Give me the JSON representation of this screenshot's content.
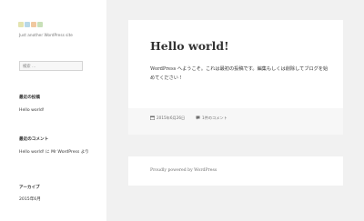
{
  "sidebar": {
    "logo": {
      "colors": [
        "#e4e4b0",
        "#b8d8e8",
        "#f0c8a0",
        "#c8e0b8"
      ]
    },
    "tagline": "Just another WordPress site",
    "search": {
      "placeholder": "検索 …"
    },
    "recent_posts": {
      "title": "最近の投稿",
      "items": [
        "Hello world!"
      ]
    },
    "recent_comments": {
      "title": "最近のコメント",
      "text": "Hello world! に Mr WordPress より"
    },
    "archives": {
      "title": "アーカイブ",
      "items": [
        "2015年6月"
      ]
    }
  },
  "post": {
    "title": "Hello world!",
    "body": "WordPress へようこそ。これは最初の投稿です。編集もしくは削除してブログを始めてください !",
    "date": "2015年6月26日",
    "comments": "1件のコメント",
    "date_icon": "calendar-icon",
    "comments_icon": "comment-bubble-icon"
  },
  "footer": {
    "text": "Proudly powered by WordPress"
  }
}
